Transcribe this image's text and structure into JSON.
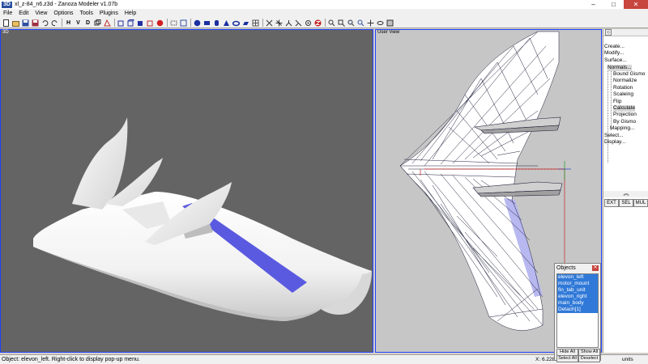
{
  "window": {
    "logo": "3D",
    "title": "xl_z-84_n6.z3d - Zanoza Modeler v1.07b",
    "minimize": "–",
    "maximize": "□",
    "close": "✕"
  },
  "menu": [
    "File",
    "Edit",
    "View",
    "Options",
    "Tools",
    "Plugins",
    "Help"
  ],
  "toolbar": {
    "letters": [
      "H",
      "V",
      "D"
    ]
  },
  "viewport_left": {
    "label": "3D",
    "background": "#646464"
  },
  "viewport_right": {
    "label": "User View",
    "background": "#c6c6c6"
  },
  "sidepanel": {
    "tree": [
      {
        "label": "Create...",
        "indent": 0,
        "selected": false
      },
      {
        "label": "Modify...",
        "indent": 0,
        "selected": false
      },
      {
        "label": "Surface...",
        "indent": 0,
        "selected": false
      },
      {
        "label": "Normals...",
        "indent": 1,
        "selected": true
      },
      {
        "label": "Bound Gismo",
        "indent": 2,
        "selected": false
      },
      {
        "label": "Normalize",
        "indent": 2,
        "selected": false
      },
      {
        "label": "Rotation",
        "indent": 2,
        "selected": false
      },
      {
        "label": "Scaleing",
        "indent": 2,
        "selected": false
      },
      {
        "label": "Flip",
        "indent": 2,
        "selected": false
      },
      {
        "label": "Calculate",
        "indent": 2,
        "selected": true
      },
      {
        "label": "Projection",
        "indent": 2,
        "selected": false
      },
      {
        "label": "By Gismo",
        "indent": 2,
        "selected": false
      },
      {
        "label": "Mapping...",
        "indent": 1,
        "selected": false
      },
      {
        "label": "Select...",
        "indent": 0,
        "selected": false
      },
      {
        "label": "Display...",
        "indent": 0,
        "selected": false
      }
    ],
    "scroll_glyph": "︽",
    "mode_buttons": [
      "EXT",
      "SEL",
      "MUL"
    ]
  },
  "objects_panel": {
    "title": "Objects",
    "items": [
      "elevon_left",
      "motor_mount",
      "fin_tab_unit",
      "elevon_right",
      "main_body",
      "Detach[1]"
    ],
    "selected": [
      0,
      1,
      2,
      3,
      4,
      5
    ],
    "buttons": [
      "Hide All",
      "Show All",
      "Select All",
      "Deselect"
    ]
  },
  "status": {
    "message": "Object: elevon_left. Right-click to display pop-up menu.",
    "coords": "X: 6.2281",
    "coords_tail": "8192",
    "units": "units"
  },
  "colors": {
    "accent_blue": "#2040ff",
    "elevon": "#5a5ae0",
    "selection": "#3079d8"
  }
}
